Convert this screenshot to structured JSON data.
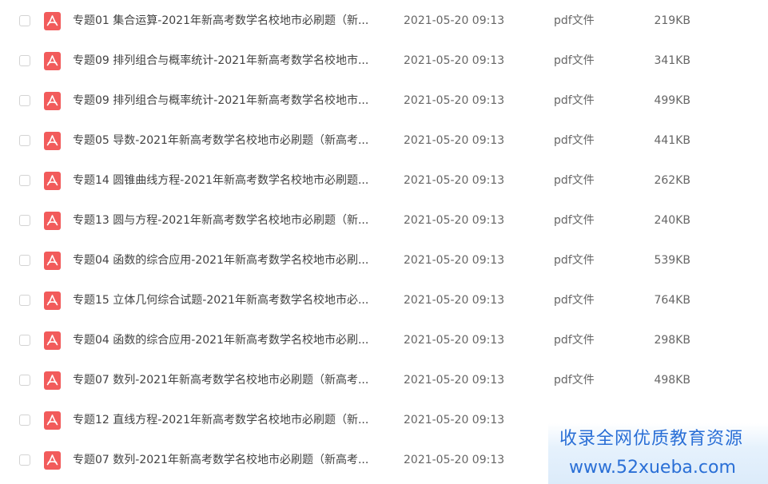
{
  "files": [
    {
      "name": "专题01 集合运算-2021年新高考数学名校地市必刷题（新...",
      "date": "2021-05-20 09:13",
      "type": "pdf文件",
      "size": "219KB"
    },
    {
      "name": "专题09 排列组合与概率统计-2021年新高考数学名校地市...",
      "date": "2021-05-20 09:13",
      "type": "pdf文件",
      "size": "341KB"
    },
    {
      "name": "专题09 排列组合与概率统计-2021年新高考数学名校地市...",
      "date": "2021-05-20 09:13",
      "type": "pdf文件",
      "size": "499KB"
    },
    {
      "name": "专题05 导数-2021年新高考数学名校地市必刷题（新高考...",
      "date": "2021-05-20 09:13",
      "type": "pdf文件",
      "size": "441KB"
    },
    {
      "name": "专题14 圆锥曲线方程-2021年新高考数学名校地市必刷题...",
      "date": "2021-05-20 09:13",
      "type": "pdf文件",
      "size": "262KB"
    },
    {
      "name": "专题13 圆与方程-2021年新高考数学名校地市必刷题（新...",
      "date": "2021-05-20 09:13",
      "type": "pdf文件",
      "size": "240KB"
    },
    {
      "name": "专题04 函数的综合应用-2021年新高考数学名校地市必刷...",
      "date": "2021-05-20 09:13",
      "type": "pdf文件",
      "size": "539KB"
    },
    {
      "name": "专题15 立体几何综合试题-2021年新高考数学名校地市必...",
      "date": "2021-05-20 09:13",
      "type": "pdf文件",
      "size": "764KB"
    },
    {
      "name": "专题04 函数的综合应用-2021年新高考数学名校地市必刷...",
      "date": "2021-05-20 09:13",
      "type": "pdf文件",
      "size": "298KB"
    },
    {
      "name": "专题07 数列-2021年新高考数学名校地市必刷题（新高考...",
      "date": "2021-05-20 09:13",
      "type": "pdf文件",
      "size": "498KB"
    },
    {
      "name": "专题12 直线方程-2021年新高考数学名校地市必刷题（新...",
      "date": "2021-05-20 09:13",
      "type": "",
      "size": ""
    },
    {
      "name": "专题07 数列-2021年新高考数学名校地市必刷题（新高考...",
      "date": "2021-05-20 09:13",
      "type": "",
      "size": ""
    }
  ],
  "icons": {
    "file_icon": "pdf-file-icon",
    "file_icon_color": "#f25b5b"
  },
  "watermark": {
    "line1": "收录全网优质教育资源",
    "line2": "www.52xueba.com",
    "color": "#2a6fd6"
  }
}
